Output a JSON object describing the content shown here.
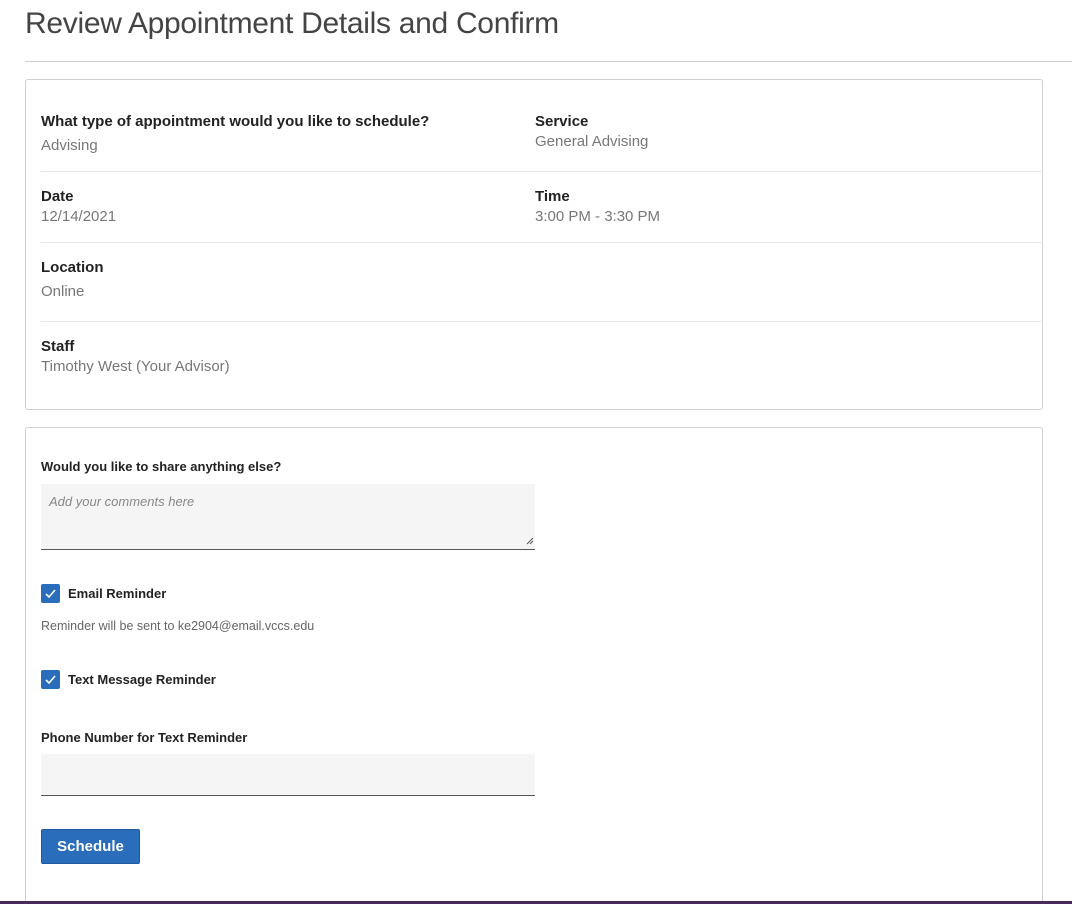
{
  "page": {
    "title": "Review Appointment Details and Confirm"
  },
  "details": {
    "appointment_type_label": "What type of appointment would you like to schedule?",
    "appointment_type_value": "Advising",
    "service_label": "Service",
    "service_value": "General Advising",
    "date_label": "Date",
    "date_value": "12/14/2021",
    "time_label": "Time",
    "time_value": "3:00 PM - 3:30 PM",
    "location_label": "Location",
    "location_value": "Online",
    "staff_label": "Staff",
    "staff_value": "Timothy West (Your Advisor)"
  },
  "form": {
    "comments_label": "Would you like to share anything else?",
    "comments_placeholder": "Add your comments here",
    "comments_value": "",
    "email_reminder_label": "Email Reminder",
    "email_reminder_checked": true,
    "email_hint": "Reminder will be sent to ke2904@email.vccs.edu",
    "text_reminder_label": "Text Message Reminder",
    "text_reminder_checked": true,
    "phone_label": "Phone Number for Text Reminder",
    "phone_value": "",
    "schedule_button": "Schedule"
  },
  "colors": {
    "accent": "#2a6ebb",
    "bottom_bar": "#4a2a5a"
  },
  "icons": {
    "checkbox_check": "check-icon",
    "textarea_resize": "resize-grip-icon"
  }
}
